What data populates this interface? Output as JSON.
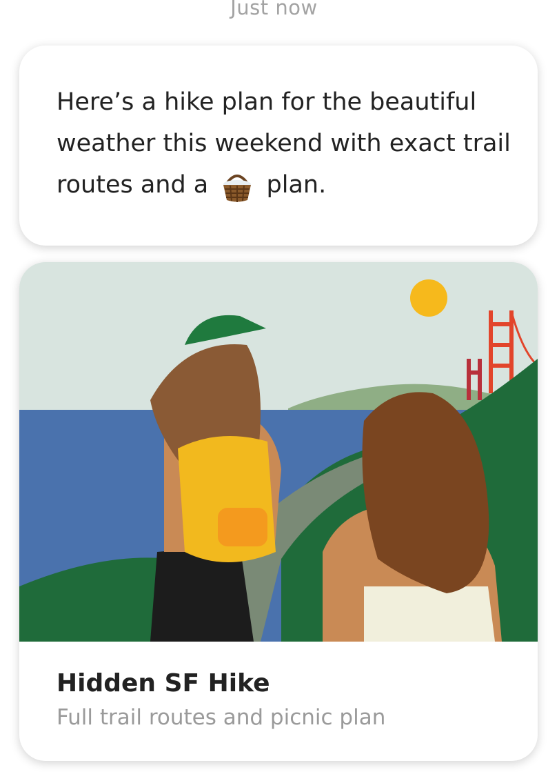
{
  "message": {
    "timestamp": "Just now",
    "text_before_emoji": "Here’s a hike plan for the beautiful weather this weekend with exact trail routes and a",
    "emoji": "picnic-basket-emoji",
    "text_after_emoji": "plan."
  },
  "card": {
    "illustration": "hikers-golden-gate-illustration",
    "title": "Hidden SF Hike",
    "subtitle": "Full trail routes and picnic plan"
  },
  "colors": {
    "sky": "#d8e4df",
    "water": "#4a72ad",
    "hill": "#1f6b3a",
    "bridge": "#e2452b",
    "sun": "#f6b91c",
    "backpack": "#f2b91e"
  }
}
